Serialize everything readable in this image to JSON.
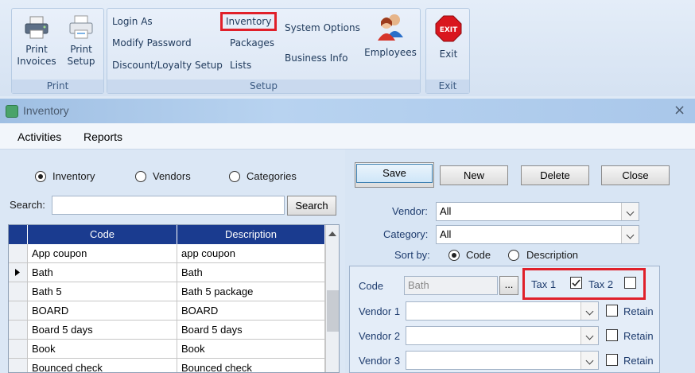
{
  "ribbon": {
    "print_group": {
      "label": "Print",
      "print_invoices": "Print\nInvoices",
      "print_invoices_l1": "Print",
      "print_invoices_l2": "Invoices",
      "print_setup_l1": "Print",
      "print_setup_l2": "Setup"
    },
    "setup_group": {
      "label": "Setup",
      "login_as": "Login As",
      "modify_password": "Modify Password",
      "discount_setup": "Discount/Loyalty Setup",
      "inventory": "Inventory",
      "packages": "Packages",
      "lists": "Lists",
      "system_options": "System Options",
      "business_info": "Business Info",
      "employees": "Employees"
    },
    "exit_group": {
      "label": "Exit",
      "exit_icon_text": "EXIT",
      "exit_label": "Exit"
    }
  },
  "window": {
    "title": "Inventory",
    "close_glyph": "×",
    "menu": [
      "Activities",
      "Reports"
    ]
  },
  "filter": {
    "options": [
      "Inventory",
      "Vendors",
      "Categories"
    ],
    "selected": "Inventory"
  },
  "search": {
    "label": "Search:",
    "value": "",
    "button": "Search"
  },
  "grid": {
    "columns": [
      "Code",
      "Description"
    ],
    "rows": [
      {
        "code": "App coupon",
        "description": "app coupon",
        "current": false
      },
      {
        "code": "Bath",
        "description": "Bath",
        "current": true
      },
      {
        "code": "Bath 5",
        "description": "Bath 5 package",
        "current": false
      },
      {
        "code": "BOARD",
        "description": "BOARD",
        "current": false
      },
      {
        "code": "Board 5 days",
        "description": "Board 5 days",
        "current": false
      },
      {
        "code": "Book",
        "description": "Book",
        "current": false
      },
      {
        "code": "Bounced check",
        "description": "Bounced check",
        "current": false
      }
    ]
  },
  "actions": {
    "save": "Save",
    "new": "New",
    "delete": "Delete",
    "close": "Close"
  },
  "filters_right": {
    "vendor_label": "Vendor:",
    "vendor_value": "All",
    "category_label": "Category:",
    "category_value": "All",
    "sortby_label": "Sort by:",
    "sort_options": [
      "Code",
      "Description"
    ],
    "sort_selected": "Code"
  },
  "detail": {
    "code_label": "Code",
    "code_value": "Bath",
    "browse": "...",
    "tax1_label": "Tax 1",
    "tax1_checked": true,
    "tax2_label": "Tax 2",
    "tax2_checked": false,
    "vendor_rows": [
      {
        "label": "Vendor 1",
        "value": "",
        "retain_label": "Retain",
        "retain": false
      },
      {
        "label": "Vendor 2",
        "value": "",
        "retain_label": "Retain",
        "retain": false
      },
      {
        "label": "Vendor 3",
        "value": "",
        "retain_label": "Retain",
        "retain": false
      }
    ]
  },
  "colors": {
    "highlight": "#e0202a",
    "grid_header": "#1a3b8f",
    "exit_red": "#d9161e"
  }
}
